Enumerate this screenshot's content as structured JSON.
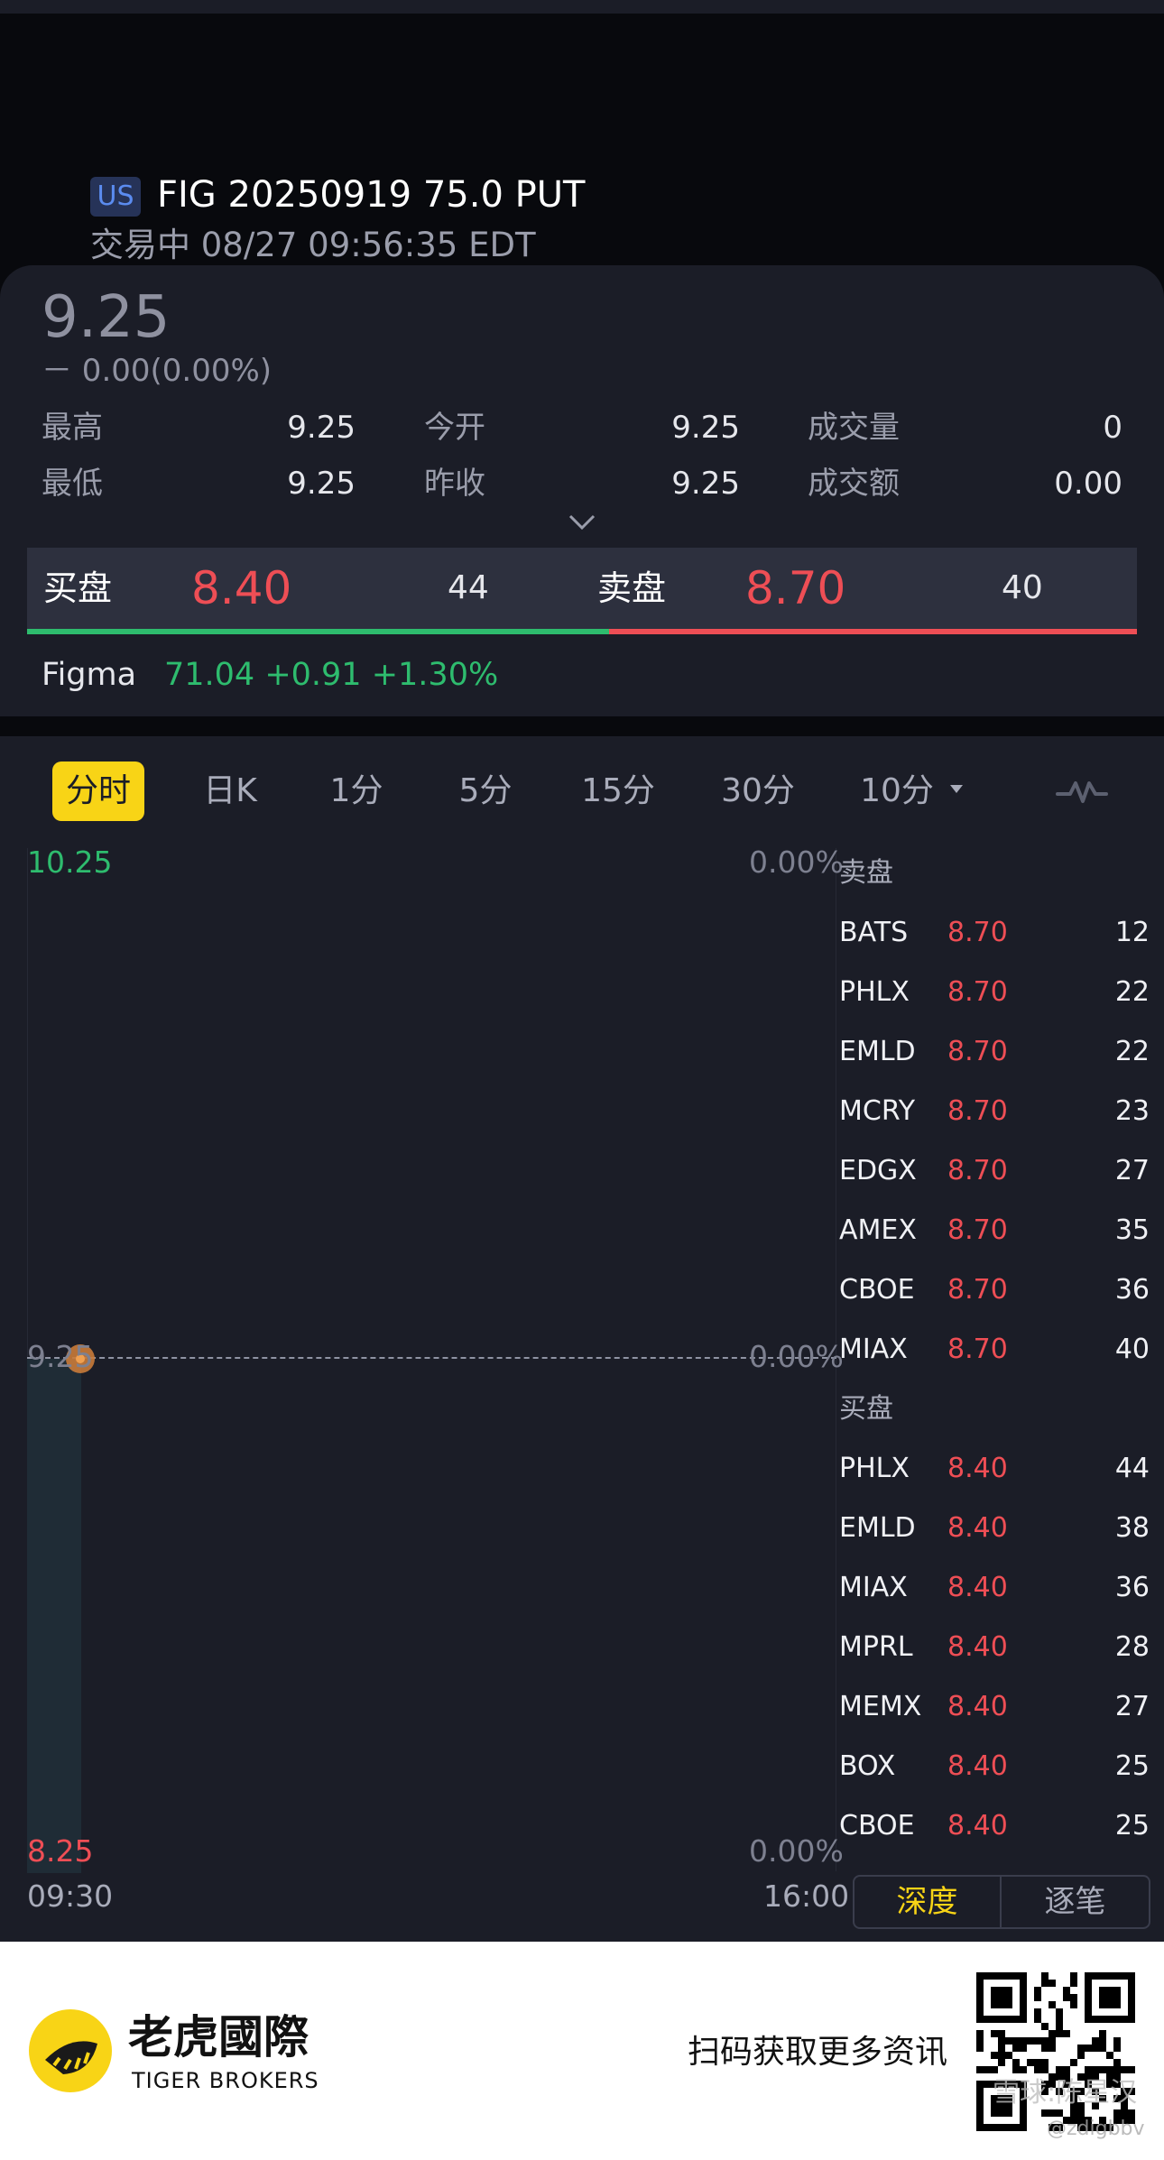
{
  "header": {
    "market": "US",
    "title": "FIG 20250919 75.0 PUT",
    "status": "交易中  08/27 09:56:35 EDT"
  },
  "quote": {
    "price": "9.25",
    "change": "－  0.00(0.00%)",
    "stats": [
      {
        "label": "最高",
        "value": "9.25"
      },
      {
        "label": "今开",
        "value": "9.25"
      },
      {
        "label": "成交量",
        "value": "0"
      },
      {
        "label": "最低",
        "value": "9.25"
      },
      {
        "label": "昨收",
        "value": "9.25"
      },
      {
        "label": "成交额",
        "value": "0.00"
      }
    ]
  },
  "bid_ask": {
    "bid_label": "买盘",
    "bid_price": "8.40",
    "bid_size": "44",
    "ask_label": "卖盘",
    "ask_price": "8.70",
    "ask_size": "40",
    "bid_ratio": 0.524
  },
  "underlying": {
    "name": "Figma",
    "quote": "71.04 +0.91 +1.30%"
  },
  "periods": [
    "分时",
    "日K",
    "1分",
    "5分",
    "15分",
    "30分",
    "10分"
  ],
  "active_period": "分时",
  "chart": {
    "y_high": "10.25",
    "y_mid": "9.25",
    "y_low": "8.25",
    "pct_high": "0.00%",
    "pct_mid": "0.00%",
    "pct_low": "0.00%",
    "x_start": "09:30",
    "x_end": "16:00"
  },
  "depth": {
    "ask_title": "卖盘",
    "asks": [
      {
        "exchange": "BATS",
        "price": "8.70",
        "size": "12"
      },
      {
        "exchange": "PHLX",
        "price": "8.70",
        "size": "22"
      },
      {
        "exchange": "EMLD",
        "price": "8.70",
        "size": "22"
      },
      {
        "exchange": "MCRY",
        "price": "8.70",
        "size": "23"
      },
      {
        "exchange": "EDGX",
        "price": "8.70",
        "size": "27"
      },
      {
        "exchange": "AMEX",
        "price": "8.70",
        "size": "35"
      },
      {
        "exchange": "CBOE",
        "price": "8.70",
        "size": "36"
      },
      {
        "exchange": "MIAX",
        "price": "8.70",
        "size": "40"
      }
    ],
    "bid_title": "买盘",
    "bids": [
      {
        "exchange": "PHLX",
        "price": "8.40",
        "size": "44"
      },
      {
        "exchange": "EMLD",
        "price": "8.40",
        "size": "38"
      },
      {
        "exchange": "MIAX",
        "price": "8.40",
        "size": "36"
      },
      {
        "exchange": "MPRL",
        "price": "8.40",
        "size": "28"
      },
      {
        "exchange": "MEMX",
        "price": "8.40",
        "size": "27"
      },
      {
        "exchange": "BOX",
        "price": "8.40",
        "size": "25"
      },
      {
        "exchange": "CBOE",
        "price": "8.40",
        "size": "25"
      }
    ]
  },
  "depth_tabs": {
    "depth": "深度",
    "trades": "逐笔"
  },
  "footer": {
    "brand_cn": "老虎國際",
    "brand_en": "TIGER BROKERS",
    "scan_text": "扫码获取更多资讯",
    "watermark": "雪球:陈星汉",
    "watermark_handle": "@zdigbbv"
  },
  "colors": {
    "up": "#2ebc6e",
    "down": "#ee4e55",
    "accent": "#f8d416",
    "panel": "#1b1d27"
  }
}
